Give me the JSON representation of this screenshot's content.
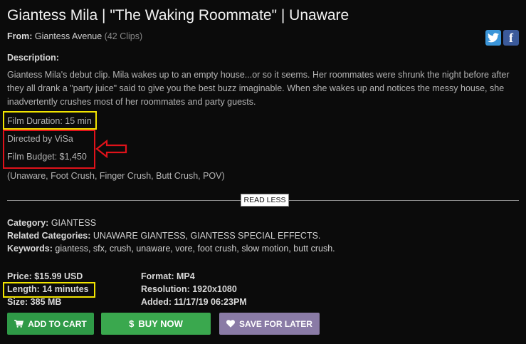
{
  "product": {
    "title": "Giantess Mila | \"The Waking Roommate\" | Unaware",
    "from_label": "From:",
    "from_value": "Giantess Avenue",
    "clip_count": "(42 Clips)"
  },
  "social": {
    "twitter_icon": "twitter-icon",
    "facebook_icon": "facebook-icon",
    "facebook_glyph": "f"
  },
  "description": {
    "heading": "Description:",
    "text": "Giantess Mila's debut clip. Mila wakes up to an empty house...or so it seems. Her roommates were shrunk the night before after they all drank a \"party juice\" said to give you the best buzz imaginable. When she wakes up and notices the messy house, she inadvertently crushes most of her roommates and party guests.",
    "film_duration": "Film Duration: 15 min",
    "directed_by": "Directed by ViSa",
    "film_budget": "Film Budget: $1,450",
    "tags": "(Unaware, Foot Crush, Finger Crush, Butt Crush, POV)"
  },
  "read_less_label": "READ LESS",
  "categories": {
    "category_label": "Category:",
    "category_value": "GIANTESS",
    "related_label": "Related Categories:",
    "related_value": "UNAWARE GIANTESS, GIANTESS SPECIAL EFFECTS.",
    "keywords_label": "Keywords:",
    "keywords_value": "giantess, sfx, crush, unaware, vore, foot crush, slow motion, butt crush."
  },
  "details": {
    "price_label": "Price:",
    "price_value": "$15.99 USD",
    "length_label": "Length:",
    "length_value": "14 minutes",
    "size_label": "Size:",
    "size_value": "385 MB",
    "format_label": "Format:",
    "format_value": "MP4",
    "resolution_label": "Resolution:",
    "resolution_value": "1920x1080",
    "added_label": "Added:",
    "added_value": "11/17/19 06:23PM"
  },
  "buttons": {
    "add_to_cart": "ADD TO CART",
    "buy_now": "BUY NOW",
    "buy_now_symbol": "$",
    "save_for_later": "SAVE FOR LATER"
  },
  "annotation_colors": {
    "yellow": "#f2e400",
    "red": "#e0121a"
  }
}
